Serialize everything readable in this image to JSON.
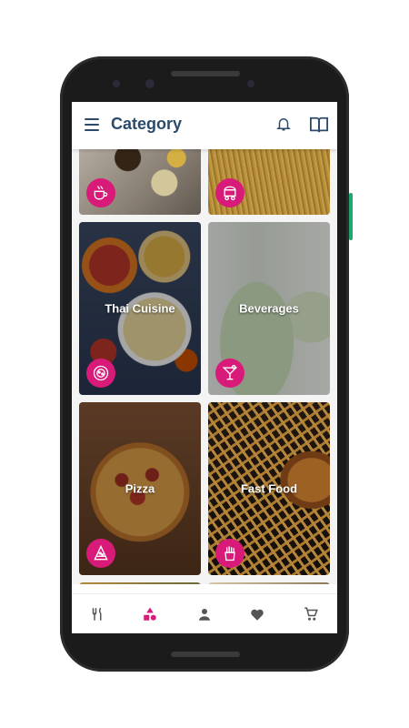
{
  "appbar": {
    "title": "Category"
  },
  "icons": {
    "menu": "menu-icon",
    "bell": "bell-icon",
    "book": "book-icon"
  },
  "categories": [
    {
      "label": "",
      "icon": "tea-cup-icon"
    },
    {
      "label": "",
      "icon": "food-cart-icon"
    },
    {
      "label": "Thai Cuisine",
      "icon": "plate-icon"
    },
    {
      "label": "Beverages",
      "icon": "cocktail-icon"
    },
    {
      "label": "Pizza",
      "icon": "pizza-slice-icon"
    },
    {
      "label": "Fast Food",
      "icon": "french-fries-icon"
    }
  ],
  "bottom_nav": [
    {
      "name": "restaurant-icon",
      "active": false
    },
    {
      "name": "category-icon",
      "active": true
    },
    {
      "name": "profile-icon",
      "active": false
    },
    {
      "name": "favorite-icon",
      "active": false
    },
    {
      "name": "cart-icon",
      "active": false
    }
  ],
  "colors": {
    "accent": "#d81b78",
    "title": "#2c4a6a",
    "nav_inactive": "#555555"
  }
}
